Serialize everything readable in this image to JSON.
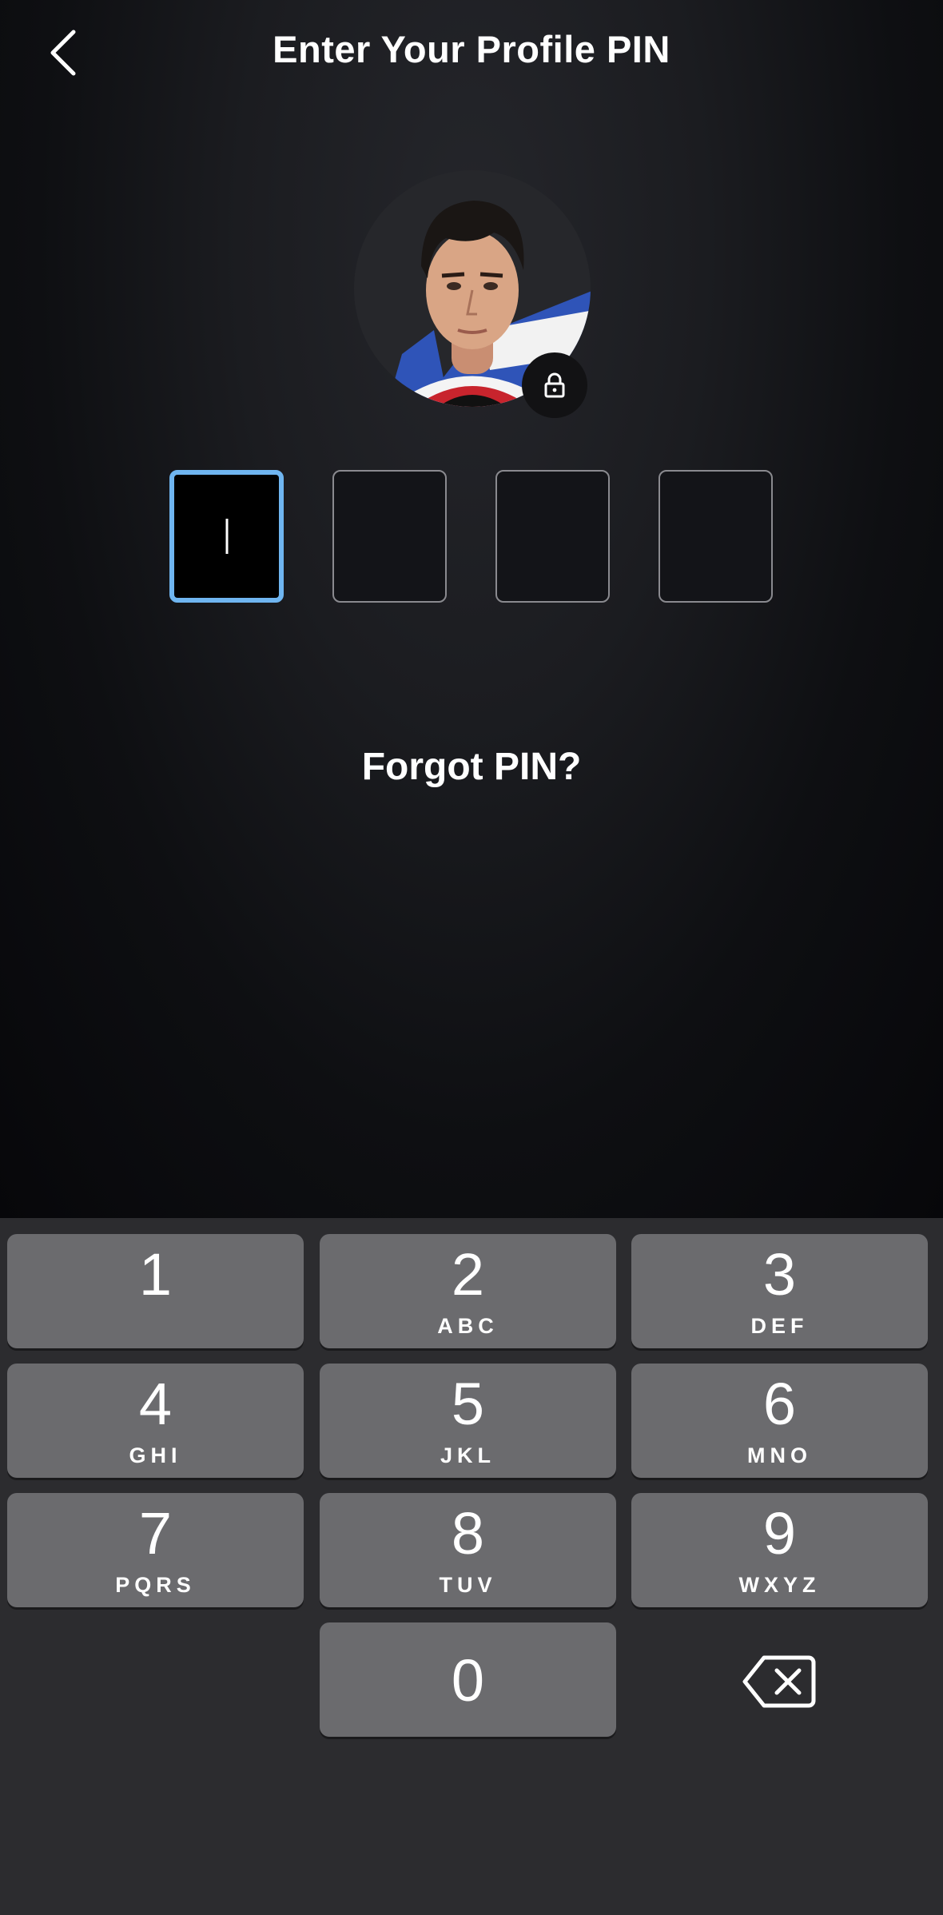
{
  "header": {
    "title": "Enter Your Profile PIN",
    "back_icon": "chevron-left-icon"
  },
  "profile": {
    "avatar": "profile-avatar",
    "badge_icon": "lock-icon"
  },
  "pin": {
    "length": 4,
    "entered": 0,
    "active_index": 0
  },
  "links": {
    "forgot_pin": "Forgot PIN?"
  },
  "keypad": {
    "keys": [
      {
        "num": "1",
        "letters": ""
      },
      {
        "num": "2",
        "letters": "ABC"
      },
      {
        "num": "3",
        "letters": "DEF"
      },
      {
        "num": "4",
        "letters": "GHI"
      },
      {
        "num": "5",
        "letters": "JKL"
      },
      {
        "num": "6",
        "letters": "MNO"
      },
      {
        "num": "7",
        "letters": "PQRS"
      },
      {
        "num": "8",
        "letters": "TUV"
      },
      {
        "num": "9",
        "letters": "WXYZ"
      },
      {
        "num": "0",
        "letters": ""
      }
    ],
    "delete_icon": "backspace-icon"
  },
  "colors": {
    "active_border": "#6fb5f0",
    "key_bg": "#6b6b6e",
    "keypad_bg": "#2c2c2f"
  }
}
